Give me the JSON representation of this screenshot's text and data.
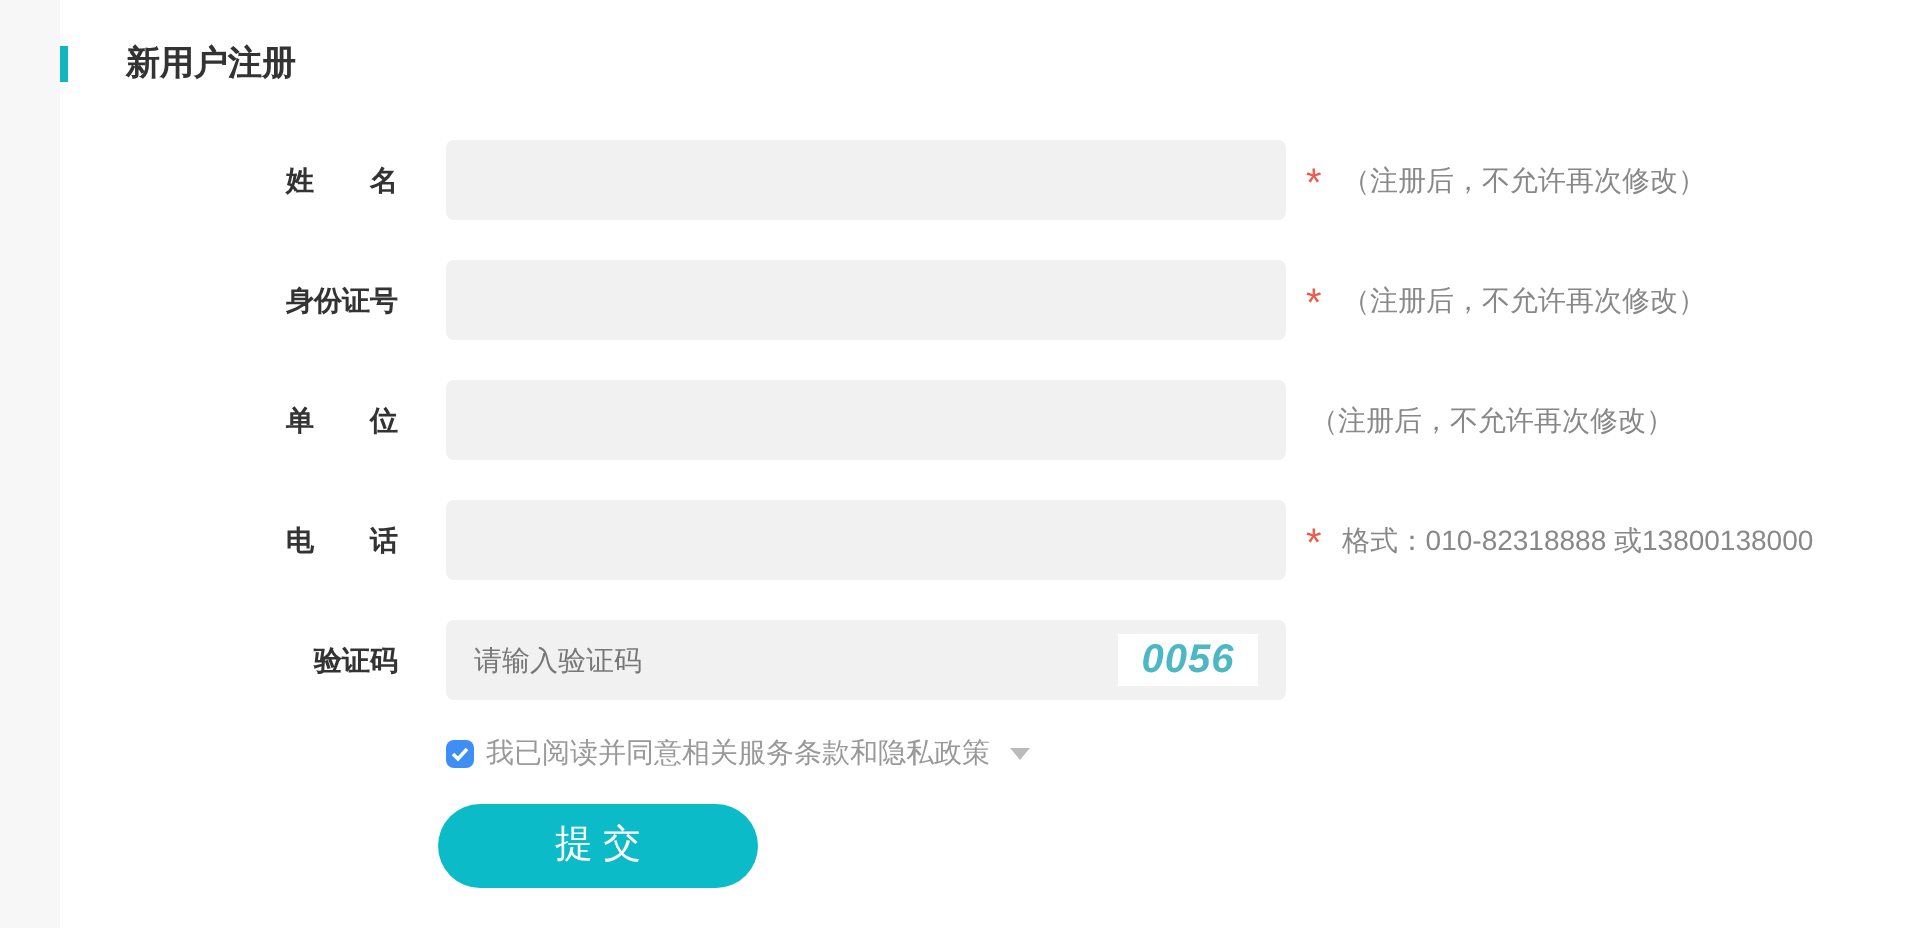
{
  "title": "新用户注册",
  "fields": [
    {
      "label": "姓　　名",
      "mark": "*",
      "note": "（注册后，不允许再次修改）"
    },
    {
      "label": "身份证号",
      "mark": "*",
      "note": "（注册后，不允许再次修改）"
    },
    {
      "label": "单　　位",
      "note": "（注册后，不允许再次修改）"
    },
    {
      "label": "电　　话",
      "mark": "*",
      "note": "格式：010-82318888 或13800138000"
    }
  ],
  "captcha": {
    "label": "验证码",
    "placeholder": "请输入验证码",
    "code": "0056"
  },
  "agreement": {
    "text": "我已阅读并同意相关服务条款和隐私政策",
    "checked": true
  },
  "submit": "提 交"
}
